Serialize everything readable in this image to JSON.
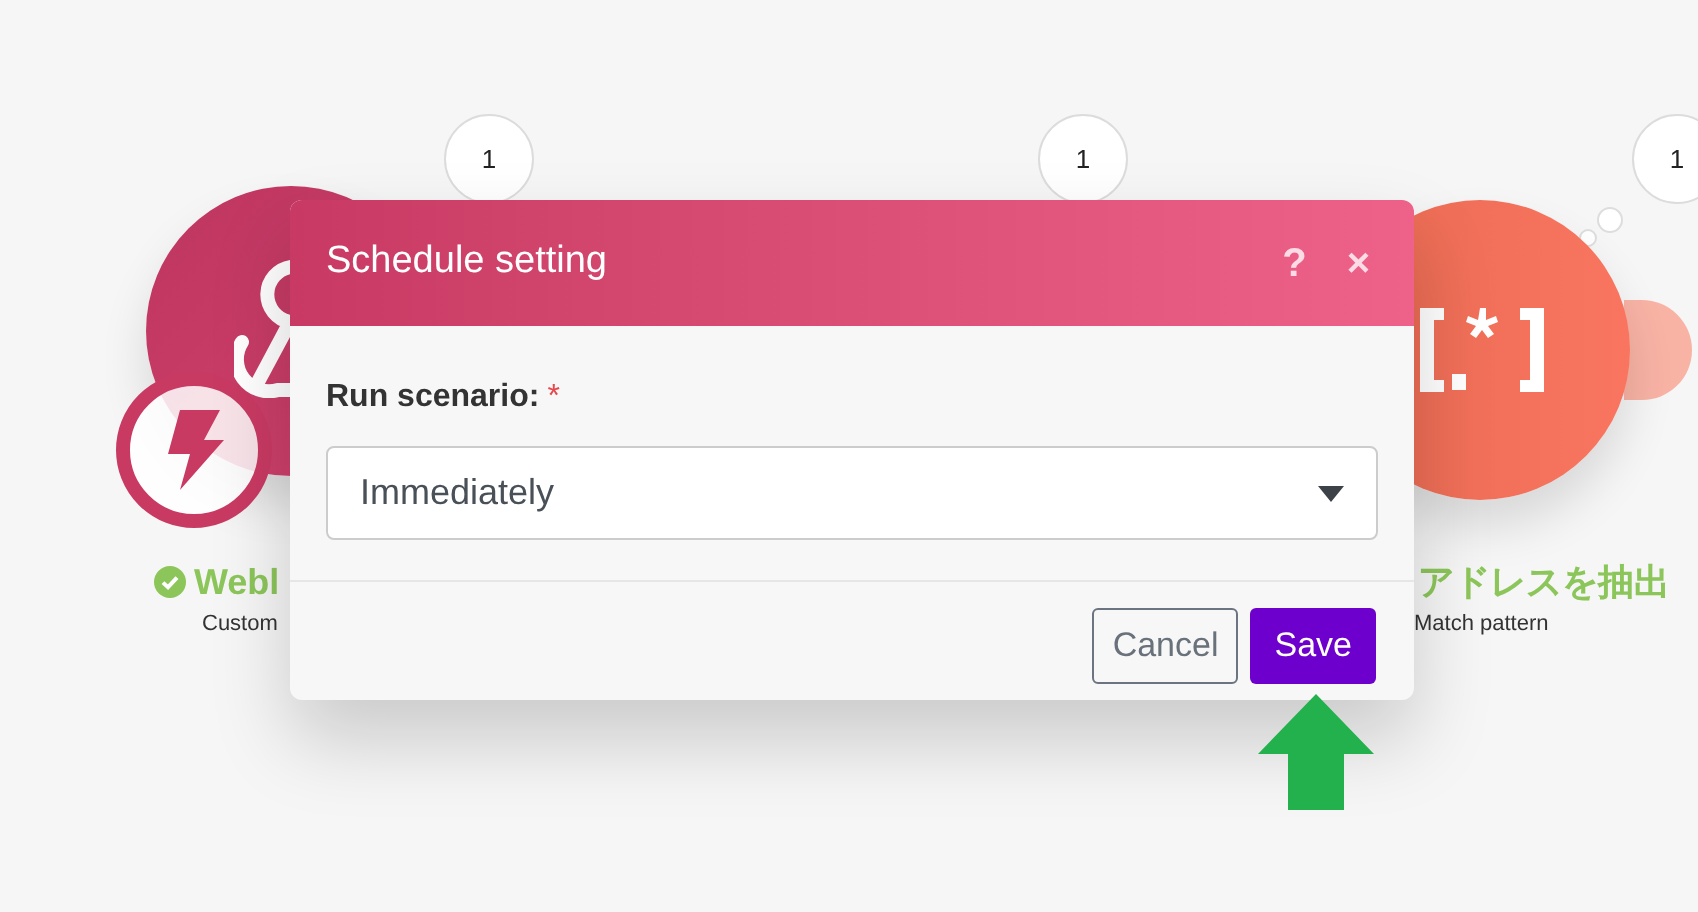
{
  "canvas": {
    "counter_bubbles": [
      {
        "label": "1"
      },
      {
        "label": "1"
      },
      {
        "label": "1"
      }
    ],
    "nodes": [
      {
        "kind": "webhook",
        "done": true,
        "title": "Webl",
        "subtitle": "Custom"
      },
      {
        "kind": "regex",
        "title": "アドレスを抽出",
        "subtitle": "Match pattern"
      }
    ]
  },
  "dialog": {
    "title": "Schedule setting",
    "header_actions": [
      "?",
      "×"
    ],
    "field": {
      "label": "Run scenario:",
      "required": true,
      "required_mark": "*",
      "value": "Immediately"
    },
    "buttons": [
      {
        "kind": "secondary",
        "label": "Cancel"
      },
      {
        "kind": "primary",
        "label": "Save"
      }
    ]
  },
  "annotation": {
    "kind": "up-arrow"
  }
}
